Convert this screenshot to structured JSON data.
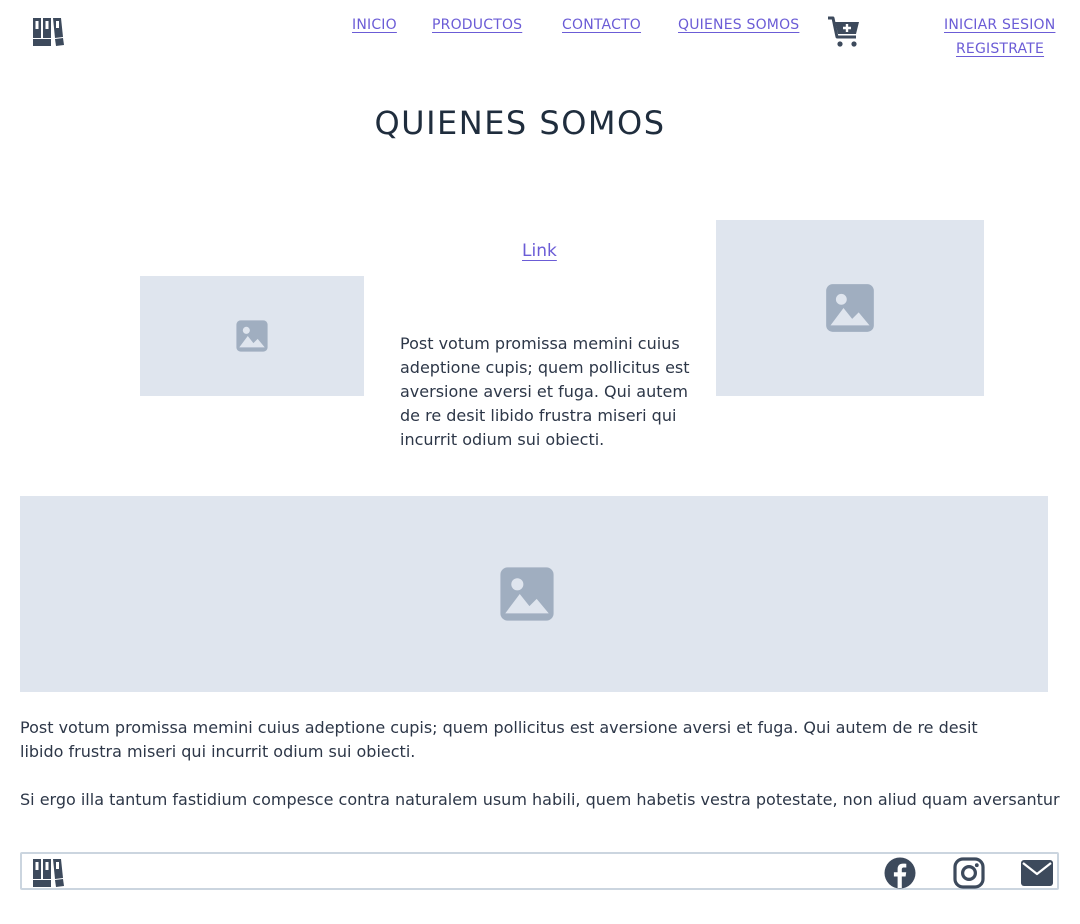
{
  "header": {
    "logo": "bookshelf-logo-icon",
    "nav": {
      "inicio": "INICIO",
      "productos": "PRODUCTOS",
      "contacto": "CONTACTO",
      "quienes_somos": "QUIENES SOMOS"
    },
    "cart_icon": "cart-add-icon",
    "auth": {
      "login": "INICIAR SESION",
      "register": "REGISTRATE"
    }
  },
  "main": {
    "title": "QUIENES SOMOS",
    "link_label": "Link",
    "side_paragraph": "Post votum promissa memini cuius adeptione cupis; quem pollicitus est aversione aversi et fuga. Qui autem de re desit libido frustra miseri qui incurrit odium sui obiecti.",
    "paragraph_1": "Post votum promissa memini cuius adeptione cupis; quem pollicitus est aversione aversi et fuga. Qui autem de re desit libido frustra miseri qui incurrit odium sui obiecti.",
    "paragraph_2": "Si ergo illa tantum fastidium compesce contra naturalem usum habili, quem habetis vestra potestate, non aliud quam aversantur"
  },
  "footer": {
    "logo": "bookshelf-logo-icon",
    "social": [
      "facebook-icon",
      "instagram-icon",
      "mail-icon"
    ]
  },
  "colors": {
    "link": "#6b5cd6",
    "placeholder_bg": "#dfe5ee",
    "placeholder_icon": "#a0aec0",
    "icon_dark": "#3d4a5c"
  }
}
